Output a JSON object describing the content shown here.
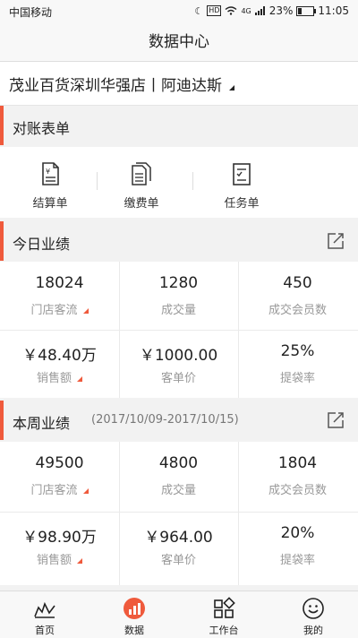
{
  "status_bar": {
    "carrier": "中国移动",
    "network": "4G",
    "battery_percent": "23%",
    "battery_level": 0.23,
    "time": "11:05"
  },
  "nav": {
    "title": "数据中心"
  },
  "store": {
    "name": "茂业百货深圳华强店丨阿迪达斯"
  },
  "reconcile": {
    "title": "对账表单",
    "items": [
      {
        "label": "结算单",
        "icon": "settlement-doc-icon"
      },
      {
        "label": "缴费单",
        "icon": "payment-doc-icon"
      },
      {
        "label": "任务单",
        "icon": "task-doc-icon"
      }
    ]
  },
  "today": {
    "title": "今日业绩",
    "metrics": [
      {
        "value": "18024",
        "label": "门店客流",
        "has_indicator": true
      },
      {
        "value": "1280",
        "label": "成交量",
        "has_indicator": false
      },
      {
        "value": "450",
        "label": "成交会员数",
        "has_indicator": false
      },
      {
        "value": "￥48.40万",
        "label": "销售额",
        "has_indicator": true
      },
      {
        "value": "￥1000.00",
        "label": "客单价",
        "has_indicator": false
      },
      {
        "value": "25%",
        "label": "提袋率",
        "has_indicator": false
      }
    ]
  },
  "week": {
    "title": "本周业绩",
    "range": "(2017/10/09-2017/10/15)",
    "metrics": [
      {
        "value": "49500",
        "label": "门店客流",
        "has_indicator": true
      },
      {
        "value": "4800",
        "label": "成交量",
        "has_indicator": false
      },
      {
        "value": "1804",
        "label": "成交会员数",
        "has_indicator": false
      },
      {
        "value": "￥98.90万",
        "label": "销售额",
        "has_indicator": true
      },
      {
        "value": "￥964.00",
        "label": "客单价",
        "has_indicator": false
      },
      {
        "value": "20%",
        "label": "提袋率",
        "has_indicator": false
      }
    ]
  },
  "tabbar": {
    "items": [
      {
        "label": "首页",
        "icon": "home-icon",
        "active": false
      },
      {
        "label": "数据",
        "icon": "data-chart-icon",
        "active": true
      },
      {
        "label": "工作台",
        "icon": "workbench-icon",
        "active": false
      },
      {
        "label": "我的",
        "icon": "profile-icon",
        "active": false
      }
    ]
  },
  "colors": {
    "accent": "#ef5a3c",
    "background": "#f2f2f2"
  }
}
